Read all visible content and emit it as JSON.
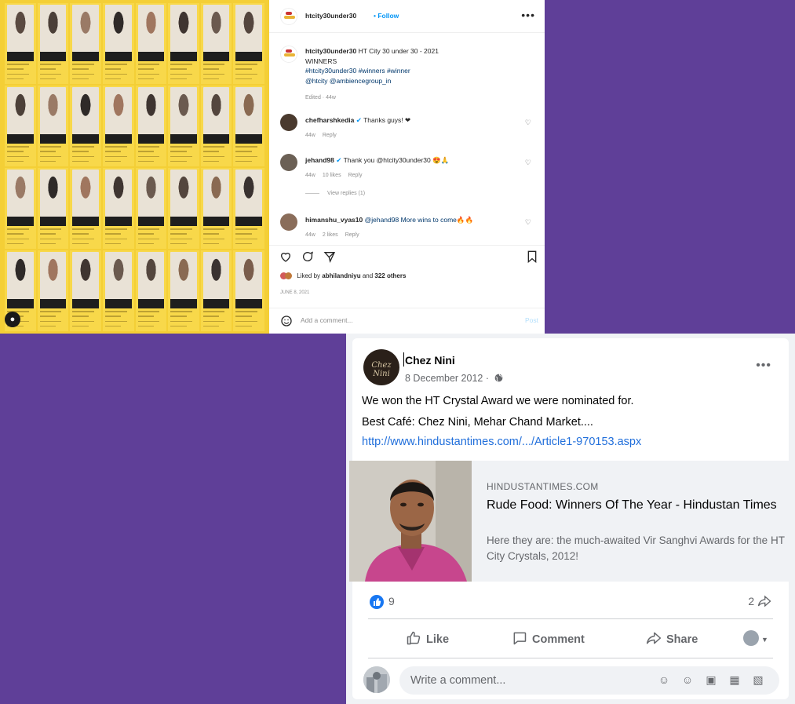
{
  "instagram": {
    "username": "htcity30under30",
    "follow": "Follow",
    "more": "•••",
    "caption_user": "htcity30under30",
    "caption_line1": "HT City 30 under 30 - 2021",
    "caption_line2": "WINNERS",
    "caption_tags1": "#htcity30under30 #winners #winner",
    "caption_tags2": "@htcity @ambiencegroup_in",
    "edited": "Edited · 44w",
    "comments": [
      {
        "user": "chefharshkedia",
        "text": "Thanks guys! ❤",
        "time": "44w",
        "likes": "",
        "reply": "Reply"
      },
      {
        "user": "jehand98",
        "text": "Thank you @htcity30under30 😍🙏",
        "time": "44w",
        "likes": "10 likes",
        "reply": "Reply",
        "view_replies": "View replies (1)"
      },
      {
        "user": "himanshu_vyas10",
        "text": "@jehand98 More wins to come🔥🔥",
        "time": "44w",
        "likes": "2 likes",
        "reply": "Reply"
      }
    ],
    "liked_by_prefix": "Liked by ",
    "liked_by_user": "abhilandniyu",
    "liked_by_suffix": " and ",
    "liked_by_count": "322 others",
    "date": "JUNE 8, 2021",
    "add_comment_placeholder": "Add a comment...",
    "post_label": "Post"
  },
  "facebook": {
    "page_name": "Chez Nini",
    "date": "8 December 2012 ·",
    "avatar_text": "Chez Nini",
    "more": "•••",
    "post_line1": "We won the HT Crystal Award we were nominated for.",
    "post_line2": "Best Café: Chez Nini, Mehar Chand Market....",
    "link": "http://www.hindustantimes.com/.../Article1-970153.aspx",
    "preview": {
      "domain": "HINDUSTANTIMES.COM",
      "title": "Rude Food: Winners Of The Year - Hindustan Times",
      "description": "Here they are: the much-awaited Vir Sanghvi Awards for the HT City Crystals, 2012!"
    },
    "reactions_count": "9",
    "shares_count": "2",
    "actions": {
      "like": "Like",
      "comment": "Comment",
      "share": "Share"
    },
    "comment_placeholder": "Write a comment..."
  },
  "colors": {
    "background": "#5f3f98",
    "collage": "#f4cf36",
    "ig_blue": "#0095f6",
    "fb_blue": "#1877f2",
    "fb_link": "#216fdb"
  }
}
